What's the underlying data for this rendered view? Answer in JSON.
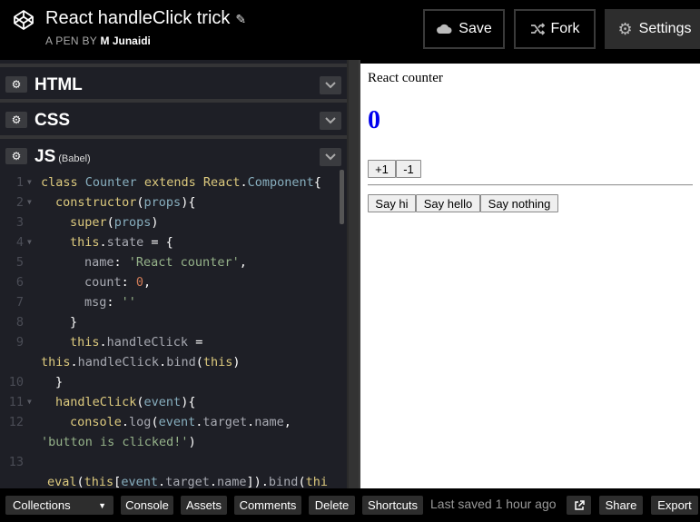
{
  "header": {
    "title": "React handleClick trick",
    "byline_prefix": "A PEN BY",
    "author": "M Junaidi",
    "save_label": "Save",
    "fork_label": "Fork",
    "settings_label": "Settings"
  },
  "panels": {
    "html": {
      "name": "HTML"
    },
    "css": {
      "name": "CSS"
    },
    "js": {
      "name": "JS",
      "sub": "(Babel)"
    }
  },
  "code": {
    "line_numbers": [
      "1",
      "2",
      "3",
      "4",
      "5",
      "6",
      "7",
      "8",
      "9",
      "",
      "10",
      "11",
      "12",
      "",
      "13"
    ],
    "l1": {
      "a": "class ",
      "b": "Counter",
      "c": " extends ",
      "d": "React",
      "e": ".",
      "f": "Component",
      "g": "{"
    },
    "l2": {
      "a": "constructor",
      "b": "(",
      "c": "props",
      "d": "){"
    },
    "l3": {
      "a": "super",
      "b": "(",
      "c": "props",
      "d": ")"
    },
    "l4": {
      "a": "this",
      "b": ".",
      "c": "state",
      "d": " = {"
    },
    "l5": {
      "a": "name",
      "b": ": ",
      "c": "'React counter'",
      "d": ","
    },
    "l6": {
      "a": "count",
      "b": ": ",
      "c": "0",
      "d": ","
    },
    "l7": {
      "a": "msg",
      "b": ": ",
      "c": "''"
    },
    "l8": {
      "a": "}"
    },
    "l9": {
      "a": "this",
      "b": ".",
      "c": "handleClick",
      "d": " ="
    },
    "l9b": {
      "a": "this",
      "b": ".",
      "c": "handleClick",
      "d": ".",
      "e": "bind",
      "f": "(",
      "g": "this",
      "h": ")"
    },
    "l10": {
      "a": "}"
    },
    "l11": {
      "a": "handleClick",
      "b": "(",
      "c": "event",
      "d": "){"
    },
    "l12": {
      "a": "console",
      "b": ".",
      "c": "log",
      "d": "(",
      "e": "event",
      "f": ".",
      "g": "target",
      "h": ".",
      "i": "name",
      "j": ","
    },
    "l12b": {
      "a": "'button is clicked!'",
      "b": ")"
    },
    "l14": {
      "a": "eval",
      "b": "(",
      "c": "this",
      "d": "[",
      "e": "event",
      "f": ".",
      "g": "target",
      "h": ".",
      "i": "name",
      "j": "]).",
      "k": "bind",
      "l": "(",
      "m": "thi"
    }
  },
  "preview": {
    "title": "React counter",
    "count": "0",
    "inc_label": "+1",
    "dec_label": "-1",
    "say_hi": "Say hi",
    "say_hello": "Say hello",
    "say_nothing": "Say nothing"
  },
  "footer": {
    "collections": "Collections",
    "console": "Console",
    "assets": "Assets",
    "comments": "Comments",
    "delete": "Delete",
    "shortcuts": "Shortcuts",
    "status": "Last saved 1 hour ago",
    "share": "Share",
    "export": "Export"
  },
  "colors": {
    "accent_count": "#0000ee",
    "editor_bg": "#1e1f26"
  },
  "icons": [
    "codepen-logo-icon",
    "pencil-icon",
    "cloud-icon",
    "fork-icon",
    "gear-icon",
    "chevron-down-icon",
    "external-link-icon",
    "caret-down-icon"
  ]
}
